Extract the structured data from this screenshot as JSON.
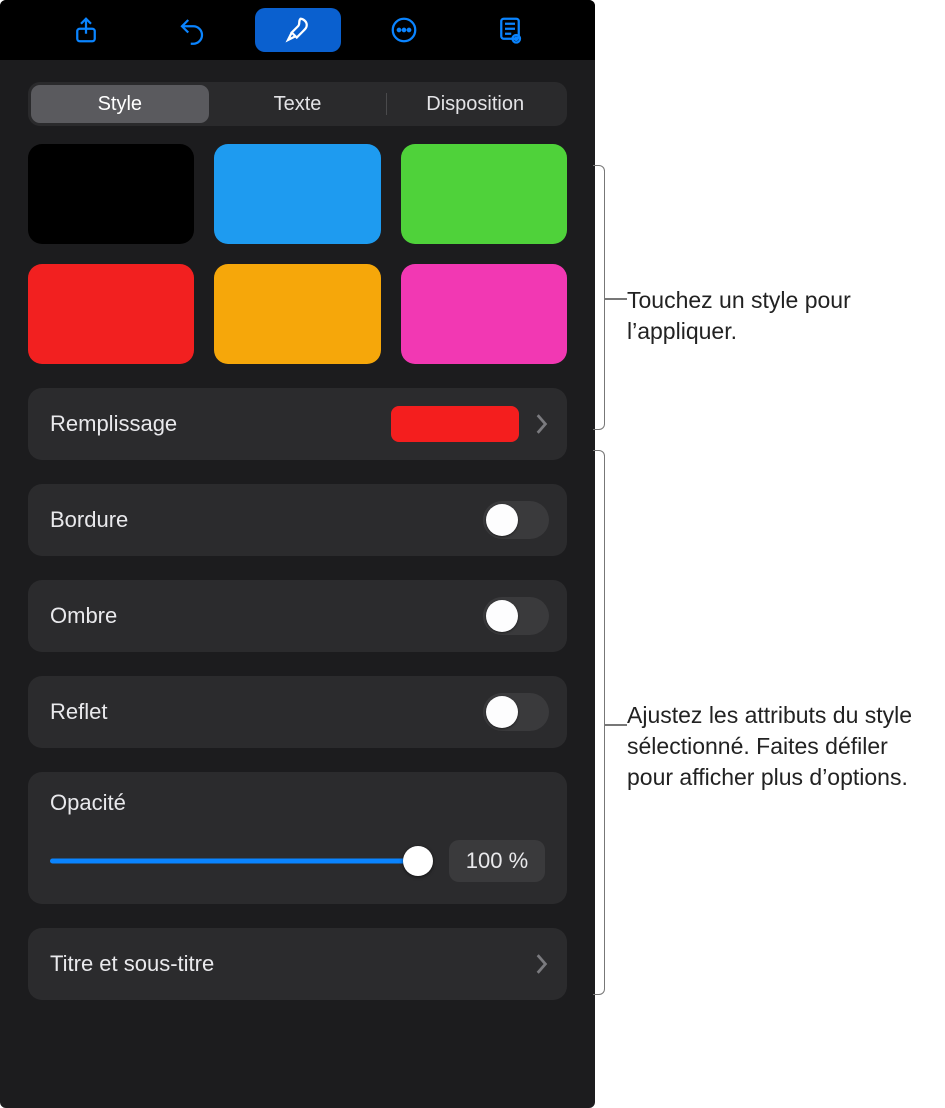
{
  "toolbar": {
    "icons": [
      "share-icon",
      "undo-icon",
      "format-brush-icon",
      "more-icon",
      "presenter-notes-icon"
    ],
    "active_index": 2
  },
  "tabs": {
    "items": [
      "Style",
      "Texte",
      "Disposition"
    ],
    "selected_index": 0
  },
  "swatches": [
    {
      "color": "#000000"
    },
    {
      "color": "#1e9bf0"
    },
    {
      "color": "#4fd23a"
    },
    {
      "color": "#f22020"
    },
    {
      "color": "#f6a70a"
    },
    {
      "color": "#f238b3"
    }
  ],
  "fill": {
    "label": "Remplissage",
    "color": "#f41e1e"
  },
  "toggles": [
    {
      "label": "Bordure",
      "on": false
    },
    {
      "label": "Ombre",
      "on": false
    },
    {
      "label": "Reflet",
      "on": false
    }
  ],
  "opacity": {
    "label": "Opacité",
    "percent": 100,
    "display": "100 %"
  },
  "title_row": {
    "label": "Titre et sous-titre"
  },
  "callouts": {
    "swatches": "Touchez un style pour l’appliquer.",
    "attributes": "Ajustez les attributs du style sélectionné. Faites défiler pour afficher plus d’options."
  }
}
